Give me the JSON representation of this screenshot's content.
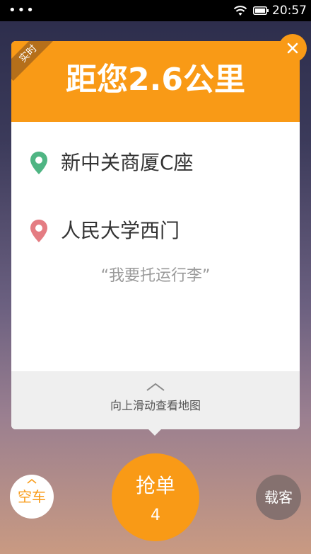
{
  "status_bar": {
    "dots": "•••",
    "time": "20:57",
    "icons": [
      "wifi-icon",
      "battery-icon"
    ]
  },
  "order_card": {
    "ribbon": "实时",
    "title": "距您2.6公里",
    "origin": "新中关商厦C座",
    "destination": "人民大学西门",
    "note": "“我要托运行李”",
    "map_hint": "向上滑动查看地图",
    "icons": [
      "origin-pin-icon",
      "destination-pin-icon",
      "chevron-up-icon",
      "close-icon"
    ]
  },
  "bottom": {
    "empty_car_label": "空车",
    "grab_label": "抢单",
    "grab_count": "4",
    "carry_label": "载客"
  },
  "colors": {
    "accent": "#f99a16",
    "origin_pin": "#4fb583",
    "destination_pin": "#e47c82",
    "carry_button": "#85716f"
  }
}
